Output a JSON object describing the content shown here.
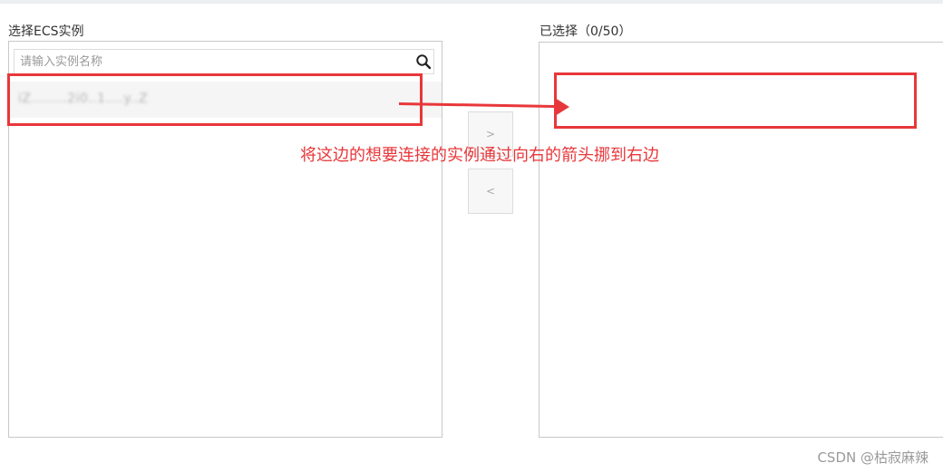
{
  "left_panel": {
    "title": "选择ECS实例",
    "search": {
      "placeholder": "请输入实例名称",
      "value": ""
    },
    "items": [
      {
        "label": "iZ........2i0..1....y..Z"
      }
    ]
  },
  "right_panel": {
    "title": "已选择（0/50）",
    "items": []
  },
  "transfer": {
    "move_right_label": ">",
    "move_left_label": "<"
  },
  "annotation": {
    "text": "将这边的想要连接的实例通过向右的箭头挪到右边",
    "color": "#e8373a"
  },
  "watermark": "CSDN @枯寂麻辣",
  "colors": {
    "border": "#c8c8c8",
    "highlight": "#e8373a",
    "item_bg": "#f5f5f5"
  }
}
